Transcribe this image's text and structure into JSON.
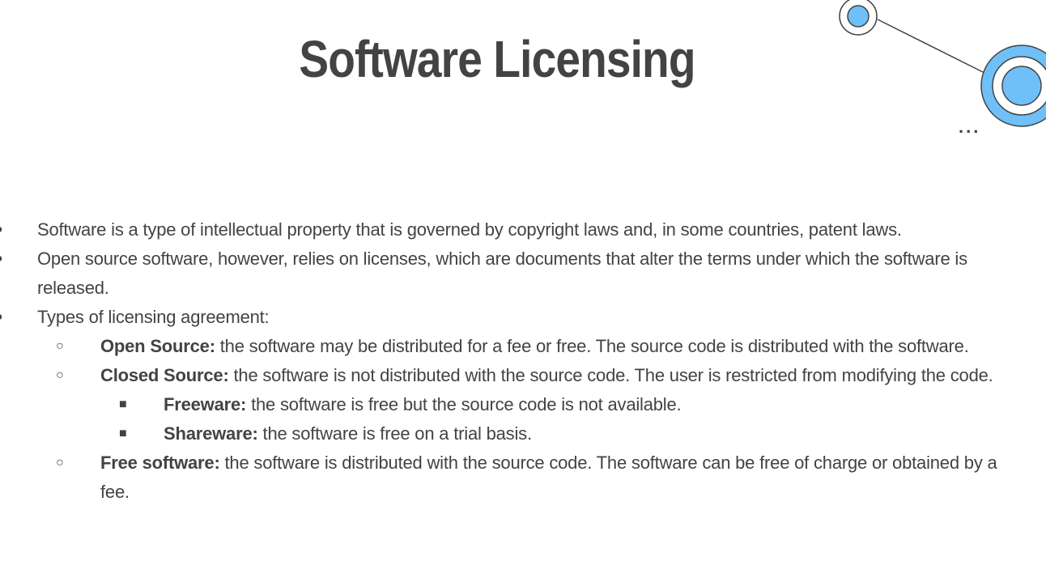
{
  "title": "Software Licensing",
  "decoration": {
    "accent_color": "#6fc0f8",
    "line_color": "#434343",
    "dots": "..."
  },
  "bullets": [
    {
      "level": 1,
      "marker": "●",
      "text": "Software is a type of intellectual property that is governed by copyright laws and, in some countries, patent laws."
    },
    {
      "level": 1,
      "marker": "●",
      "text": "Open source software, however, relies on licenses, which are documents that alter the terms under which the software is released."
    },
    {
      "level": 1,
      "marker": "●",
      "text": "Types of licensing agreement:"
    },
    {
      "level": 2,
      "marker": "○",
      "term": "Open Source:",
      "text": " the software may be distributed for a fee or free. The source code is distributed with the software."
    },
    {
      "level": 2,
      "marker": "○",
      "term": "Closed Source:",
      "text": " the software is not distributed with the source code. The user is restricted from modifying the code."
    },
    {
      "level": 3,
      "marker": "■",
      "term": "Freeware:",
      "text": " the software is free but the source code is not available."
    },
    {
      "level": 3,
      "marker": "■",
      "term": "Shareware:",
      "text": " the software is free on a trial basis."
    },
    {
      "level": 2,
      "marker": "○",
      "term": "Free software:",
      "text": " the software is distributed with the source code. The software can be free of charge or obtained by a fee."
    }
  ]
}
